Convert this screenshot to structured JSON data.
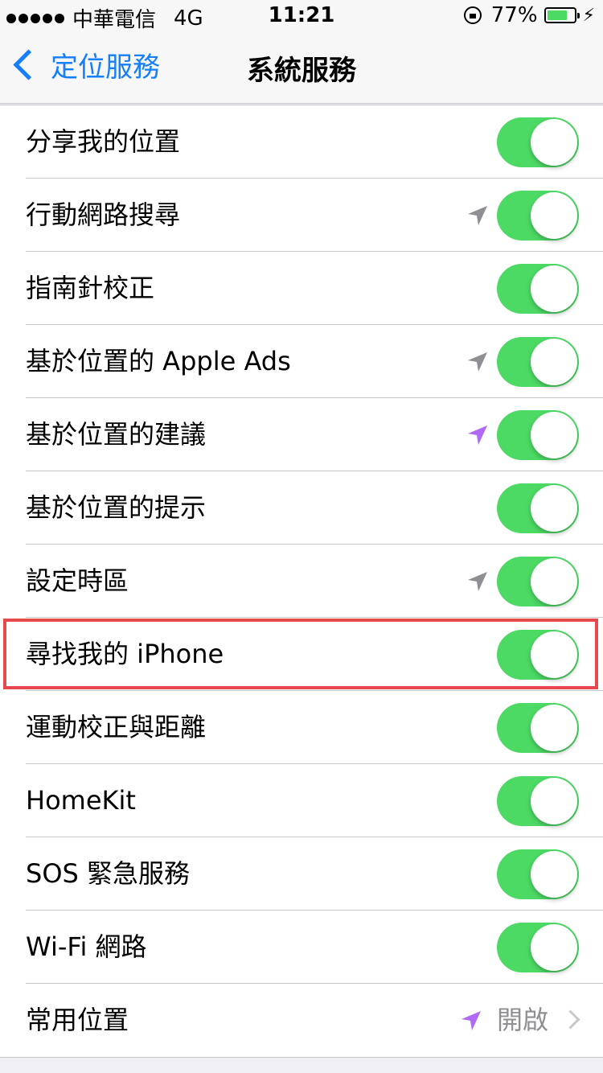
{
  "status_bar": {
    "carrier": "中華電信",
    "network": "4G",
    "time": "11:21",
    "battery": "77%",
    "battery_level": 0.77
  },
  "nav": {
    "back_label": "定位服務",
    "title": "系統服務"
  },
  "rows": [
    {
      "label": "分享我的位置",
      "toggle": "on",
      "arrow": null
    },
    {
      "label": "行動網路搜尋",
      "toggle": "on",
      "arrow": "gray"
    },
    {
      "label": "指南針校正",
      "toggle": "on",
      "arrow": null
    },
    {
      "label": "基於位置的 Apple Ads",
      "toggle": "on",
      "arrow": "gray"
    },
    {
      "label": "基於位置的建議",
      "toggle": "on",
      "arrow": "purple"
    },
    {
      "label": "基於位置的提示",
      "toggle": "on",
      "arrow": null
    },
    {
      "label": "設定時區",
      "toggle": "on",
      "arrow": "gray"
    },
    {
      "label": "尋找我的 iPhone",
      "toggle": "on",
      "arrow": null,
      "highlighted": true
    },
    {
      "label": "運動校正與距離",
      "toggle": "on",
      "arrow": null
    },
    {
      "label": "HomeKit",
      "toggle": "on",
      "arrow": null
    },
    {
      "label": "SOS 緊急服務",
      "toggle": "on",
      "arrow": null
    },
    {
      "label": "Wi-Fi 網路",
      "toggle": "on",
      "arrow": null
    },
    {
      "label": "常用位置",
      "value": "開啟",
      "arrow": "purple",
      "disclosure": true
    }
  ],
  "colors": {
    "toggle_on": "#4cd964",
    "tint": "#157efb",
    "arrow_gray": "#8e8e93",
    "arrow_purple": "#b069f5",
    "highlight": "#e5484d"
  }
}
